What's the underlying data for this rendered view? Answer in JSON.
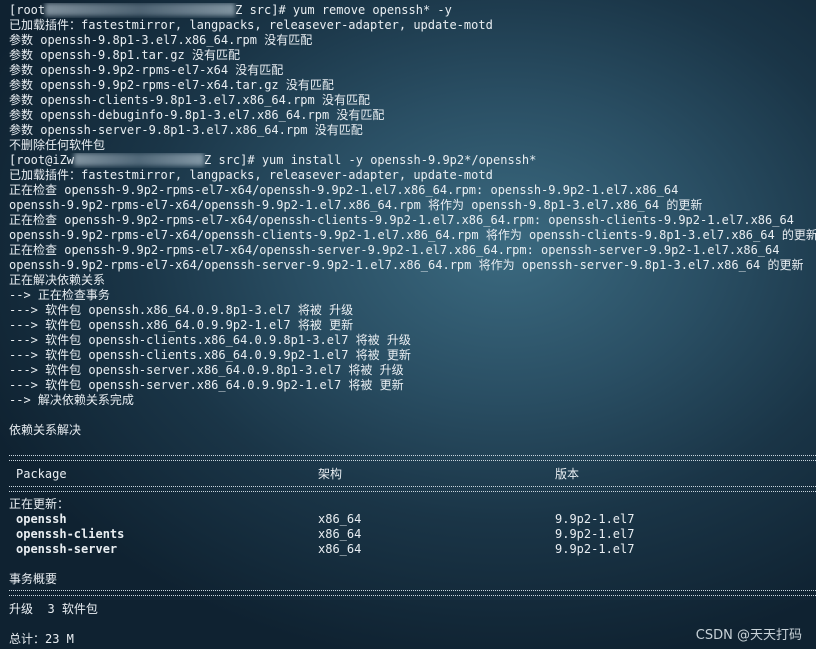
{
  "lines": [
    {
      "pre": "[root",
      "post": "Z src]# yum remove openssh* -y",
      "redact": 190
    },
    {
      "text": "已加载插件：fastestmirror, langpacks, releasever-adapter, update-motd"
    },
    {
      "text": "参数 openssh-9.8p1-3.el7.x86_64.rpm 没有匹配"
    },
    {
      "text": "参数 openssh-9.8p1.tar.gz 没有匹配"
    },
    {
      "text": "参数 openssh-9.9p2-rpms-el7-x64 没有匹配"
    },
    {
      "text": "参数 openssh-9.9p2-rpms-el7-x64.tar.gz 没有匹配"
    },
    {
      "text": "参数 openssh-clients-9.8p1-3.el7.x86_64.rpm 没有匹配"
    },
    {
      "text": "参数 openssh-debuginfo-9.8p1-3.el7.x86_64.rpm 没有匹配"
    },
    {
      "text": "参数 openssh-server-9.8p1-3.el7.x86_64.rpm 没有匹配"
    },
    {
      "text": "不删除任何软件包"
    },
    {
      "pre": "[root@iZw",
      "post": "Z src]# yum install -y openssh-9.9p2*/openssh*",
      "redact": 130
    },
    {
      "text": "已加载插件：fastestmirror, langpacks, releasever-adapter, update-motd"
    },
    {
      "text": "正在检查 openssh-9.9p2-rpms-el7-x64/openssh-9.9p2-1.el7.x86_64.rpm: openssh-9.9p2-1.el7.x86_64"
    },
    {
      "text": "openssh-9.9p2-rpms-el7-x64/openssh-9.9p2-1.el7.x86_64.rpm 将作为 openssh-9.8p1-3.el7.x86_64 的更新"
    },
    {
      "text": "正在检查 openssh-9.9p2-rpms-el7-x64/openssh-clients-9.9p2-1.el7.x86_64.rpm: openssh-clients-9.9p2-1.el7.x86_64"
    },
    {
      "text": "openssh-9.9p2-rpms-el7-x64/openssh-clients-9.9p2-1.el7.x86_64.rpm 将作为 openssh-clients-9.8p1-3.el7.x86_64 的更新"
    },
    {
      "text": "正在检查 openssh-9.9p2-rpms-el7-x64/openssh-server-9.9p2-1.el7.x86_64.rpm: openssh-server-9.9p2-1.el7.x86_64"
    },
    {
      "text": "openssh-9.9p2-rpms-el7-x64/openssh-server-9.9p2-1.el7.x86_64.rpm 将作为 openssh-server-9.8p1-3.el7.x86_64 的更新"
    },
    {
      "text": "正在解决依赖关系"
    },
    {
      "text": "--> 正在检查事务"
    },
    {
      "text": "---> 软件包 openssh.x86_64.0.9.8p1-3.el7 将被 升级"
    },
    {
      "text": "---> 软件包 openssh.x86_64.0.9.9p2-1.el7 将被 更新"
    },
    {
      "text": "---> 软件包 openssh-clients.x86_64.0.9.8p1-3.el7 将被 升级"
    },
    {
      "text": "---> 软件包 openssh-clients.x86_64.0.9.9p2-1.el7 将被 更新"
    },
    {
      "text": "---> 软件包 openssh-server.x86_64.0.9.8p1-3.el7 将被 升级"
    },
    {
      "text": "---> 软件包 openssh-server.x86_64.0.9.9p2-1.el7 将被 更新"
    },
    {
      "text": "--> 解决依赖关系完成"
    },
    {
      "text": ""
    },
    {
      "text": "依赖关系解决"
    }
  ],
  "table": {
    "headers": [
      "Package",
      "架构",
      "版本"
    ],
    "section_label": "正在更新：",
    "rows": [
      {
        "package": "openssh",
        "arch": "x86_64",
        "version": "9.9p2-1.el7"
      },
      {
        "package": "openssh-clients",
        "arch": "x86_64",
        "version": "9.9p2-1.el7"
      },
      {
        "package": "openssh-server",
        "arch": "x86_64",
        "version": "9.9p2-1.el7"
      }
    ]
  },
  "summary": {
    "title": "事务概要",
    "upgrade": "升级  3 软件包",
    "total": "总计：23 M"
  },
  "watermark": "CSDN @天天打码"
}
